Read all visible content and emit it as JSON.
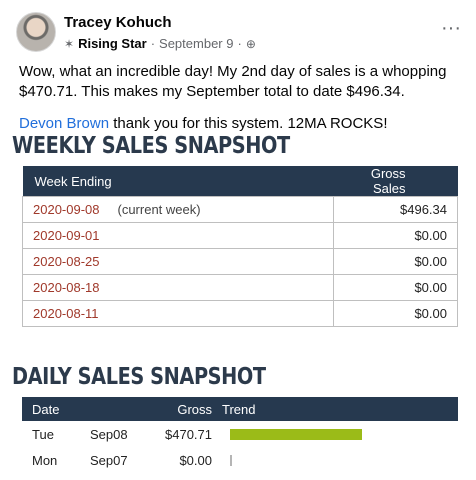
{
  "post": {
    "author": "Tracey Kohuch",
    "badge": "Rising Star",
    "date": "September 9",
    "paragraph1": "Wow, what an incredible day! My 2nd day of sales is a whopping $470.71.  This makes my September total to date $496.34.",
    "mention": "Devon Brown",
    "paragraph2_rest": " thank you for this system.  12MA ROCKS!"
  },
  "icons": {
    "badge": "star-badge-icon",
    "privacy": "globe-icon",
    "more": "more-options-icon"
  },
  "weekly": {
    "title": "WEEKLY SALES SNAPSHOT",
    "headers": [
      "Week Ending",
      "Gross Sales"
    ],
    "rows": [
      {
        "week": "2020-09-08",
        "note": "(current week)",
        "sales": "$496.34"
      },
      {
        "week": "2020-09-01",
        "note": "",
        "sales": "$0.00"
      },
      {
        "week": "2020-08-25",
        "note": "",
        "sales": "$0.00"
      },
      {
        "week": "2020-08-18",
        "note": "",
        "sales": "$0.00"
      },
      {
        "week": "2020-08-11",
        "note": "",
        "sales": "$0.00"
      }
    ]
  },
  "daily": {
    "title": "DAILY SALES SNAPSHOT",
    "headers": [
      "Date",
      "Gross",
      "Trend"
    ],
    "rows": [
      {
        "day": "Tue",
        "date": "Sep08",
        "gross": "$470.71",
        "trend_value": 470.71
      },
      {
        "day": "Mon",
        "date": "Sep07",
        "gross": "$0.00",
        "trend_value": 0.0
      }
    ]
  },
  "colors": {
    "header_bg": "#26394f",
    "title_color": "#2c3a4b",
    "week_link": "#a0392b",
    "trend_bar": "#9bbb18",
    "mention": "#216fdb"
  }
}
